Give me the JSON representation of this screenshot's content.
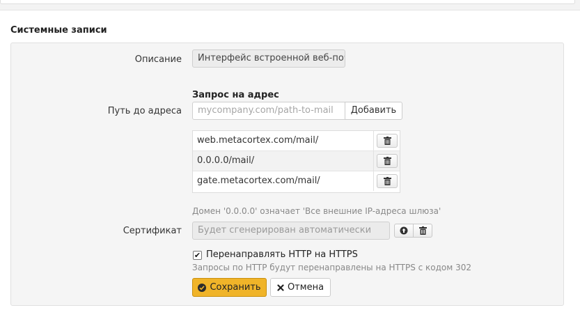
{
  "section": {
    "title": "Системные записи"
  },
  "form": {
    "description_label": "Описание",
    "description_value": "Интерфейс встроенной веб-почт",
    "request_heading": "Запрос на адрес",
    "path_label": "Путь до адреса",
    "path_placeholder": "mycompany.com/path-to-mail",
    "add_button": "Добавить",
    "paths": [
      {
        "value": "web.metacortex.com/mail/"
      },
      {
        "value": "0.0.0.0/mail/"
      },
      {
        "value": "gate.metacortex.com/mail/"
      }
    ],
    "domain_hint": "Домен '0.0.0.0' означает 'Все внешние IP-адреса шлюза'",
    "certificate_label": "Сертификат",
    "certificate_placeholder": "Будет сгенерирован автоматически",
    "redirect_checkbox_label": "Перенаправлять HTTP на HTTPS",
    "redirect_checked": true,
    "redirect_hint": "Запросы по HTTP будут перенаправлены на HTTPS с кодом 302",
    "save_button": "Сохранить",
    "cancel_button": "Отмена"
  },
  "icons": {
    "delete": "trash-icon",
    "upload": "upload-circle-icon",
    "save": "ok-circle-icon",
    "cancel": "close-icon",
    "check": "checkmark-icon"
  },
  "colors": {
    "primary_button": "#f0b429",
    "panel_background": "#f5f5f5"
  }
}
